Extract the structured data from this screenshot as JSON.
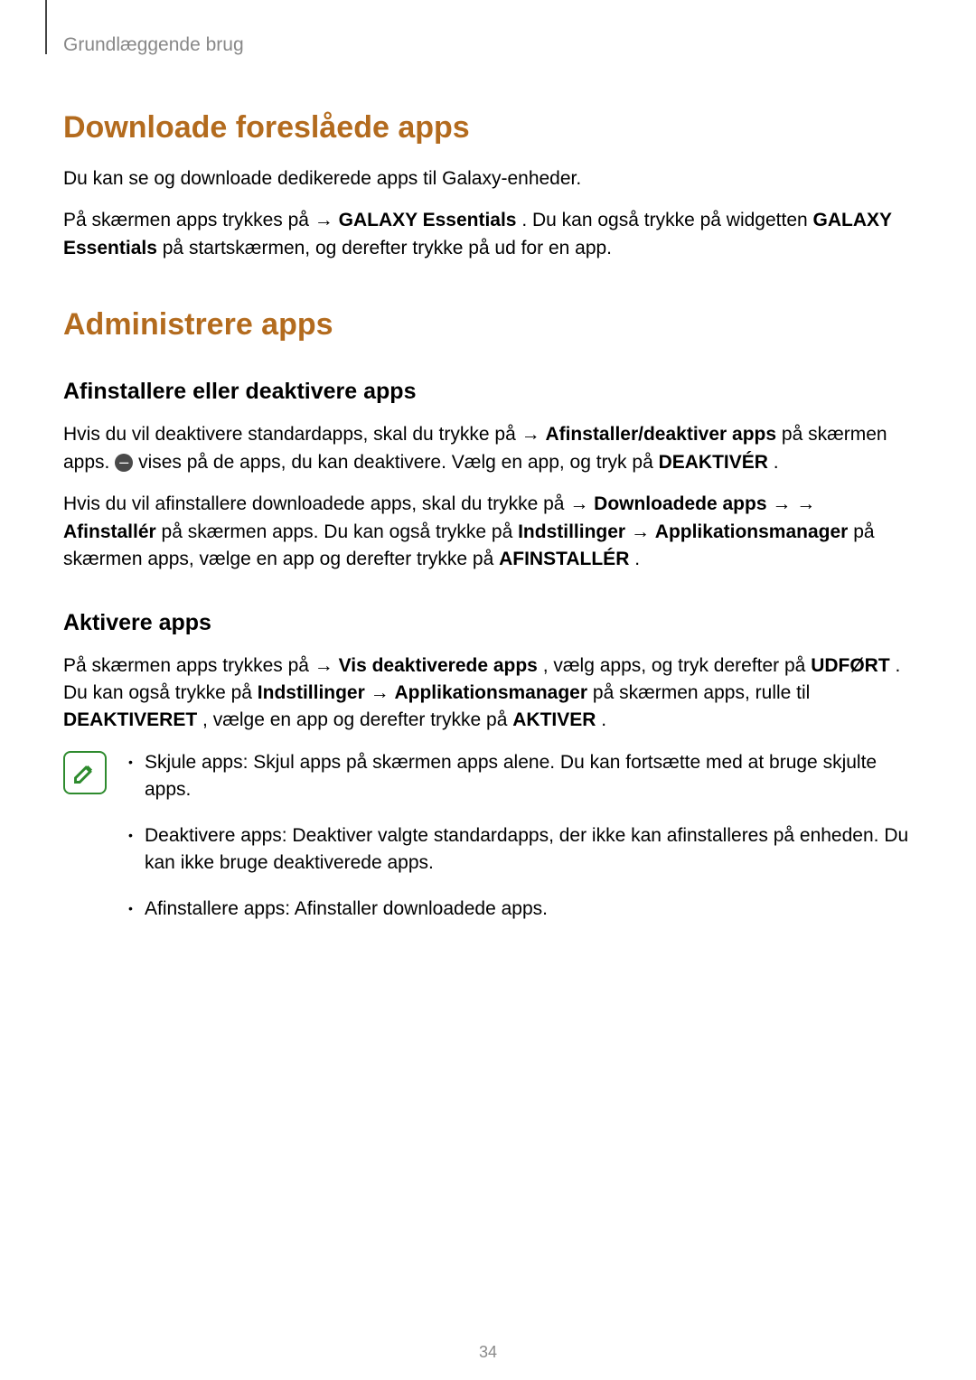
{
  "breadcrumb": "Grundlæggende brug",
  "h1_download": "Downloade foreslåede apps",
  "p_download_intro": "Du kan se og downloade dedikerede apps til Galaxy-enheder.",
  "p_download_main": {
    "t1": "På skærmen apps trykkes på ",
    "arrow1": "→ ",
    "b1": "GALAXY Essentials",
    "t2": ". Du kan også trykke på widgetten ",
    "b2": "GALAXY Essentials",
    "t3": " på startskærmen, og derefter trykke på ",
    "t4": " ud for en app."
  },
  "h1_admin": "Administrere apps",
  "h2_uninstall": "Afinstallere eller deaktivere apps",
  "p_uninstall_1": {
    "t1": "Hvis du vil deaktivere standardapps, skal du trykke på ",
    "arrow1": "→ ",
    "b1": "Afinstaller/deaktiver apps",
    "t2": " på skærmen apps. ",
    "t3": " vises på de apps, du kan deaktivere. Vælg en app, og tryk på ",
    "b2": "DEAKTIVÉR",
    "t4": "."
  },
  "p_uninstall_2": {
    "t1": "Hvis du vil afinstallere downloadede apps, skal du trykke på ",
    "arrow1": "→ ",
    "b1": "Downloadede apps",
    "arrow2": " → ",
    "arrow3": "→ ",
    "b2": "Afinstallér",
    "t2": " på skærmen apps. Du kan også trykke på ",
    "b3": "Indstillinger",
    "arrow4": " → ",
    "b4": "Applikationsmanager",
    "t3": " på skærmen apps, vælge en app og derefter trykke på ",
    "b5": "AFINSTALLÉR",
    "t4": "."
  },
  "h2_activate": "Aktivere apps",
  "p_activate": {
    "t1": "På skærmen apps trykkes på ",
    "arrow1": "→ ",
    "b1": "Vis deaktiverede apps",
    "t2": ", vælg apps, og tryk derefter på ",
    "b2": "UDFØRT",
    "t3": ". Du kan også trykke på ",
    "b3": "Indstillinger",
    "arrow2": " → ",
    "b4": "Applikationsmanager",
    "t4": " på skærmen apps, rulle til ",
    "b5": "DEAKTIVERET",
    "t5": ", vælge en app og derefter trykke på ",
    "b6": "AKTIVER",
    "t6": "."
  },
  "notes": {
    "item1": "Skjule apps: Skjul apps på skærmen apps alene. Du kan fortsætte med at bruge skjulte apps.",
    "item2": "Deaktivere apps: Deaktiver valgte standardapps, der ikke kan afinstalleres på enheden. Du kan ikke bruge deaktiverede apps.",
    "item3": "Afinstallere apps: Afinstaller downloadede apps."
  },
  "page_number": "34"
}
